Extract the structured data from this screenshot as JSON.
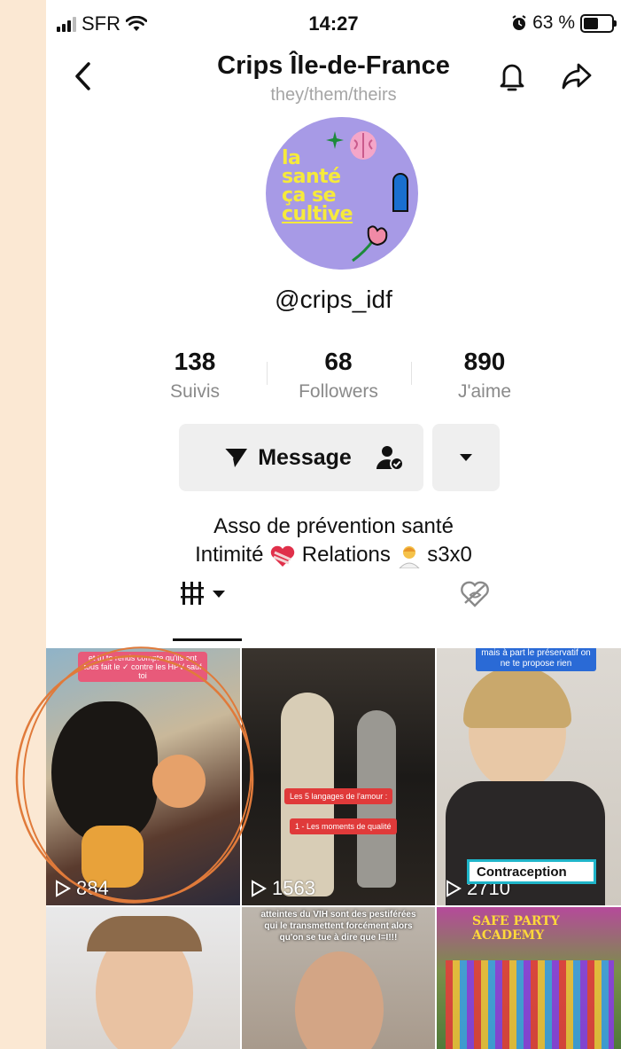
{
  "status_bar": {
    "carrier": "SFR",
    "time": "14:27",
    "battery_pct_label": "63 %",
    "battery_level": 0.63
  },
  "header": {
    "title": "Crips Île-de-France",
    "pronouns": "they/them/theirs"
  },
  "avatar": {
    "line1": "la",
    "line2": "santé",
    "line3": "ça se",
    "line4": "cultive"
  },
  "profile": {
    "username": "@crips_idf"
  },
  "stats": [
    {
      "value": "138",
      "label": "Suivis"
    },
    {
      "value": "68",
      "label": "Followers"
    },
    {
      "value": "890",
      "label": "J'aime"
    }
  ],
  "actions": {
    "message_label": "Message"
  },
  "bio": {
    "line1": "Asso de prévention santé",
    "line2_a": "Intimité",
    "line2_b": "Relations",
    "line2_c": "s3x0"
  },
  "videos": [
    {
      "views": "884",
      "caption": "et tu te rends compte qu'ils ont tous fait le ✓ contre les HPV sauf toi"
    },
    {
      "views": "1563",
      "caption": "Les 5 langages de l'amour :",
      "caption2": "1 - Les moments de qualité"
    },
    {
      "views": "2710",
      "caption": "mais à part le préservatif on ne te propose rien",
      "overlay": "Contraception"
    },
    {
      "views": "",
      "caption": ""
    },
    {
      "views": "",
      "caption": "atteintes du VIH sont des pestiférées qui le transmettent forcément alors qu'on se tue à dire que I=I!!!"
    },
    {
      "views": "",
      "caption": "SAFE PARTY ACADEMY"
    }
  ],
  "colors": {
    "avatar_bg": "#a79ae6",
    "avatar_text": "#f6ea3b",
    "annotation_circle": "#e07a3a",
    "page_bg": "#fbe8d3"
  }
}
